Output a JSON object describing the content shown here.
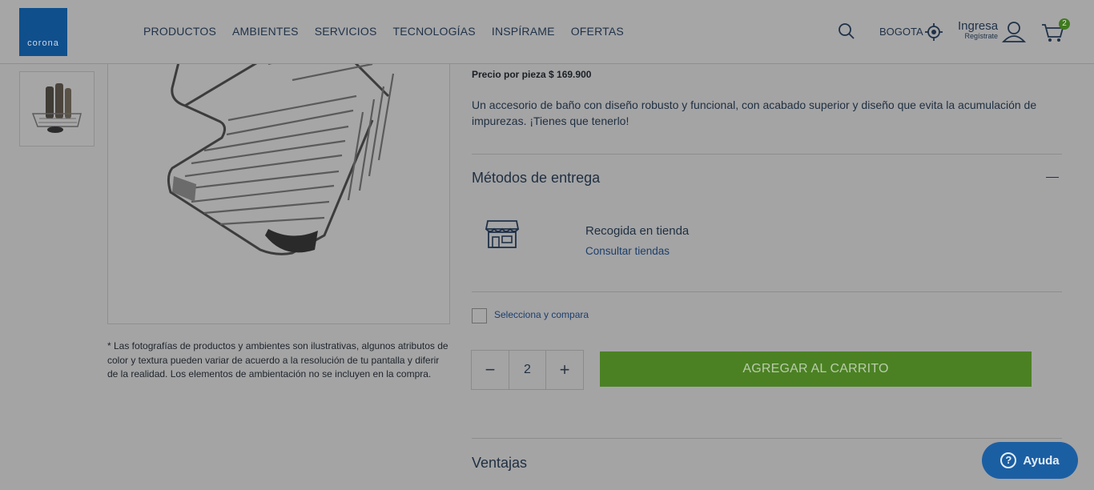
{
  "header": {
    "logo_text": "corona",
    "nav": [
      "PRODUCTOS",
      "AMBIENTES",
      "SERVICIOS",
      "TECNOLOGÍAS",
      "INSPÍRAME",
      "OFERTAS"
    ],
    "city": "BOGOTA",
    "login_label": "Ingresa",
    "register_label": "Regístrate",
    "cart_count": "2"
  },
  "gallery": {
    "disclaimer": "* Las fotografías de productos y ambientes son ilustrativas, algunos atributos de color y textura pueden variar de acuerdo a la resolución de tu pantalla y diferir de la realidad. Los elementos de ambientación no se incluyen en la compra."
  },
  "product": {
    "price_text": "Precio por pieza $ 169.900",
    "description": "Un accesorio de baño con diseño robusto y funcional, con acabado superior y diseño que evita la acumulación de impurezas. ¡Tienes que tenerlo!"
  },
  "delivery": {
    "title": "Métodos de entrega",
    "pickup_label": "Recogida en tienda",
    "consult_link": "Consultar tiendas"
  },
  "compare": {
    "label": "Selecciona y compara"
  },
  "purchase": {
    "quantity": "2",
    "minus": "−",
    "plus": "+",
    "add_to_cart": "AGREGAR AL CARRITO"
  },
  "advantages": {
    "title": "Ventajas"
  },
  "help": {
    "label": "Ayuda",
    "icon_glyph": "?"
  },
  "colors": {
    "brand": "#0f4f8c",
    "cta": "#4b8123",
    "help": "#1b5fa3"
  }
}
